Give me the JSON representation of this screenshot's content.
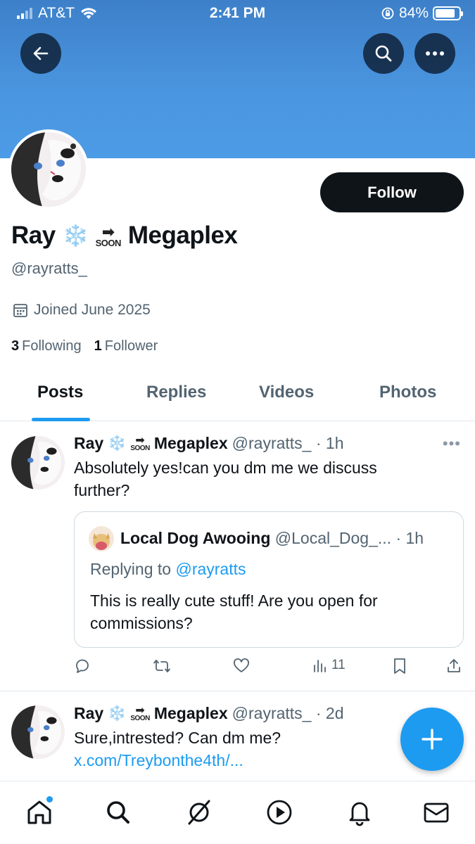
{
  "status_bar": {
    "carrier": "AT&T",
    "time": "2:41 PM",
    "battery_percent": "84%",
    "battery_level": 0.84
  },
  "header": {
    "back_icon": "arrow-left-icon",
    "search_icon": "search-icon",
    "more_icon": "more-icon"
  },
  "profile": {
    "name_first": "Ray",
    "name_emoji_1": "❄️",
    "name_emoji_2": "soon-arrow",
    "name_last": "Megaplex",
    "handle": "@rayratts_",
    "joined": "Joined June 2025",
    "following_count": "3",
    "following_label": "Following",
    "followers_count": "1",
    "followers_label": "Follower",
    "follow_button": "Follow"
  },
  "soon_text": "SOON",
  "tabs": [
    {
      "label": "Posts",
      "active": true
    },
    {
      "label": "Replies",
      "active": false
    },
    {
      "label": "Videos",
      "active": false
    },
    {
      "label": "Photos",
      "active": false
    }
  ],
  "posts": [
    {
      "name_first": "Ray",
      "name_last": "Megaplex",
      "handle_time": "@rayratts_ · 1h",
      "text": "Absolutely yes!can you dm me we discuss further?",
      "quote": {
        "name": "Local Dog Awooing",
        "handle_time": "@Local_Dog_... · 1h",
        "replying_prefix": "Replying to ",
        "replying_handle": "@rayratts",
        "text": "This is really cute stuff! Are you open for commissions?"
      },
      "views": "11"
    },
    {
      "name_first": "Ray",
      "name_last": "Megaplex",
      "handle_time": "@rayratts_ · 2d",
      "text": "Sure,intrested? Can dm me? ",
      "link_text": "x.com/Treybonthe4th/..."
    }
  ],
  "colors": {
    "accent": "#1d9bf0",
    "banner": "#4b96e0",
    "text": "#0f1419",
    "secondary_text": "#536471"
  },
  "bottom_nav": [
    "home-icon",
    "search-icon",
    "grok-icon",
    "video-icon",
    "notifications-icon",
    "messages-icon"
  ]
}
